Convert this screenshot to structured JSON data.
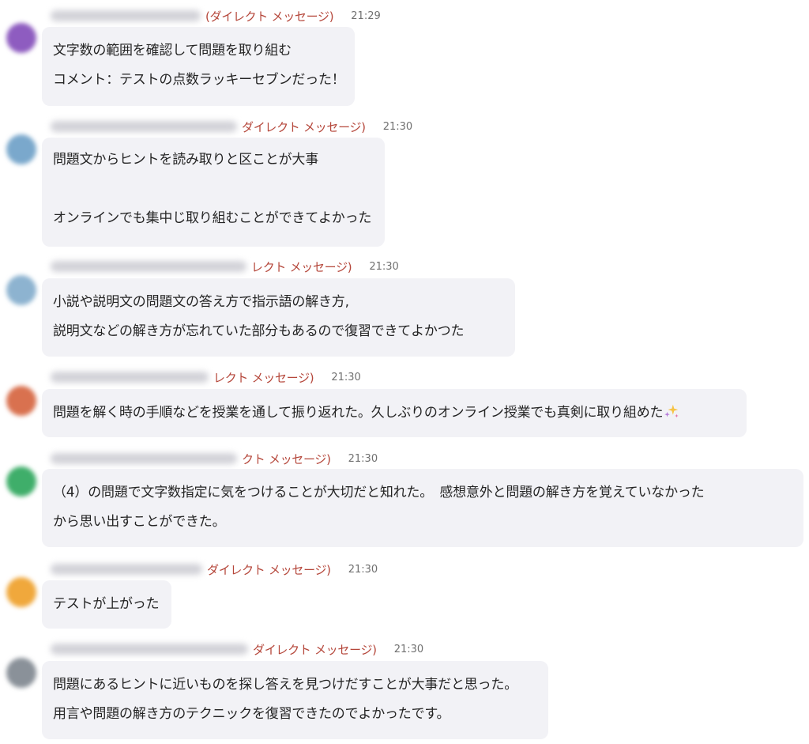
{
  "colors": {
    "dm_label": "#b5473b",
    "bubble_bg": "#f2f2f6",
    "text": "#242424",
    "time": "#707070"
  },
  "messages": [
    {
      "dm_label": "(ダイレクト メッセージ)",
      "time": "21:29",
      "avatar_color": "#8e5cc0",
      "lines": [
        "文字数の範囲を確認して問題を取り組む",
        "コメント：テストの点数ラッキーセブンだった！"
      ]
    },
    {
      "dm_label": "ダイレクト メッセージ)",
      "time": "21:30",
      "avatar_color": "#7aa8cc",
      "lines": [
        "問題文からヒントを読み取りと区ことが大事",
        "",
        "オンラインでも集中じ取り組むことができてよかった"
      ]
    },
    {
      "dm_label": "レクト メッセージ)",
      "time": "21:30",
      "avatar_color": "#8db3d0",
      "lines": [
        "小説や説明文の問題文の答え方で指示語の解き方,",
        "説明文などの解き方が忘れていた部分もあるので復習できてよかつた"
      ]
    },
    {
      "dm_label": "レクト メッセージ)",
      "time": "21:30",
      "avatar_color": "#d9714f",
      "lines": [
        "問題を解く時の手順などを授業を通して振り返れた。久しぶりのオンライン授業でも真剣に取り組めた"
      ],
      "emoji": "sparkles"
    },
    {
      "dm_label": "クト メッセージ)",
      "time": "21:30",
      "avatar_color": "#3fae6a",
      "lines": [
        "（4）の問題で文字数指定に気をつけることが大切だと知れた。　感想意外と問題の解き方を覚えていなかった",
        "から思い出すことができた。"
      ]
    },
    {
      "dm_label": "ダイレクト メッセージ)",
      "time": "21:30",
      "avatar_color": "#f0a83c",
      "lines": [
        "テストが上がった"
      ]
    },
    {
      "dm_label": "ダイレクト メッセージ)",
      "time": "21:30",
      "avatar_color": "#8a9199",
      "lines": [
        "問題にあるヒントに近いものを探し答えを見つけだすことが大事だと思った。",
        "用言や問題の解き方のテクニックを復習できたのでよかったです。"
      ]
    }
  ]
}
